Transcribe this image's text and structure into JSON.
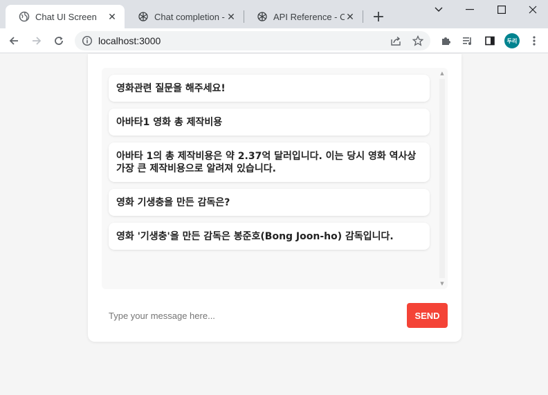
{
  "browser": {
    "tabs": [
      {
        "title": "Chat UI Screen",
        "active": true
      },
      {
        "title": "Chat completion - O",
        "active": false
      },
      {
        "title": "API Reference - Ope",
        "active": false
      }
    ],
    "new_tab_label": "+",
    "url": "localhost:3000",
    "profile_initials": "두리",
    "accent": "#00838f"
  },
  "chat": {
    "messages": [
      "영화관련 질문을 해주세요!",
      "아바타1 영화 총 제작비용",
      "아바타 1의 총 제작비용은 약 2.37억 달러입니다. 이는 당시 영화 역사상 가장 큰 제작비용으로 알려져 있습니다.",
      "영화 기생충을 만든 감독은?",
      "영화 '기생충'을 만든 감독은 봉준호(Bong Joon-ho) 감독입니다."
    ],
    "input_placeholder": "Type your message here...",
    "input_value": "",
    "send_label": "SEND",
    "send_color": "#f44336"
  }
}
